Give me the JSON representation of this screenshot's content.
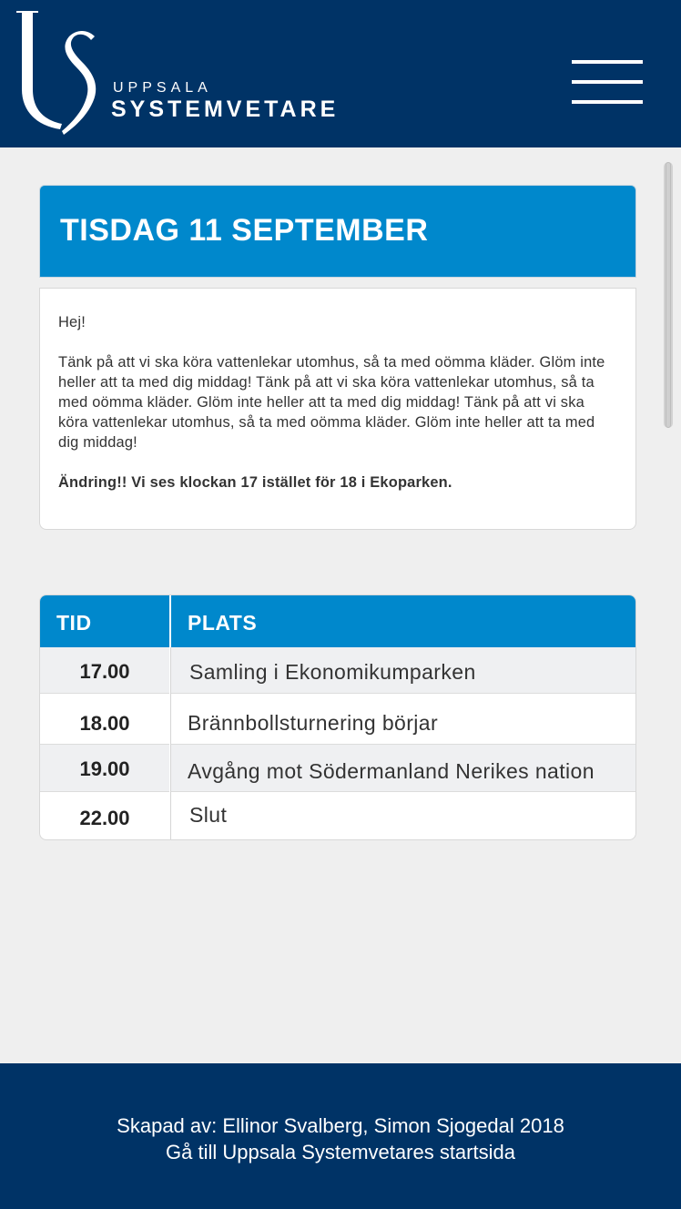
{
  "header": {
    "logo_top": "UPPSALA",
    "logo_bottom": "SYSTEMVETARE",
    "menu_icon": "hamburger-icon"
  },
  "event": {
    "title": "TISDAG 11 SEPTEMBER",
    "greeting": "Hej!",
    "body": "Tänk på att vi ska köra vattenlekar utomhus, så ta med oömma kläder. Glöm inte heller att ta med dig middag! Tänk på att vi ska köra vattenlekar utomhus, så ta med oömma kläder. Glöm inte heller att ta med dig middag! Tänk på att vi ska köra vattenlekar utomhus, så ta med oömma kläder. Glöm inte heller att ta med dig middag!",
    "change_note": "Ändring!! Vi ses klockan 17 istället för 18 i Ekoparken."
  },
  "schedule": {
    "headers": {
      "time": "TID",
      "place": "PLATS"
    },
    "rows": [
      {
        "time": "17.00",
        "place": "Samling i Ekonomikumparken"
      },
      {
        "time": "18.00",
        "place": "Brännbollsturnering börjar"
      },
      {
        "time": "19.00",
        "place": "Avgång mot Södermanland Nerikes nation"
      },
      {
        "time": "22.00",
        "place": "Slut"
      }
    ]
  },
  "footer": {
    "credit": "Skapad av: Ellinor Svalberg, Simon Sjogedal 2018",
    "home_link": "Gå till Uppsala Systemvetares startsida"
  },
  "colors": {
    "navy": "#003366",
    "accent_blue": "#0088cc",
    "background": "#efefef"
  }
}
